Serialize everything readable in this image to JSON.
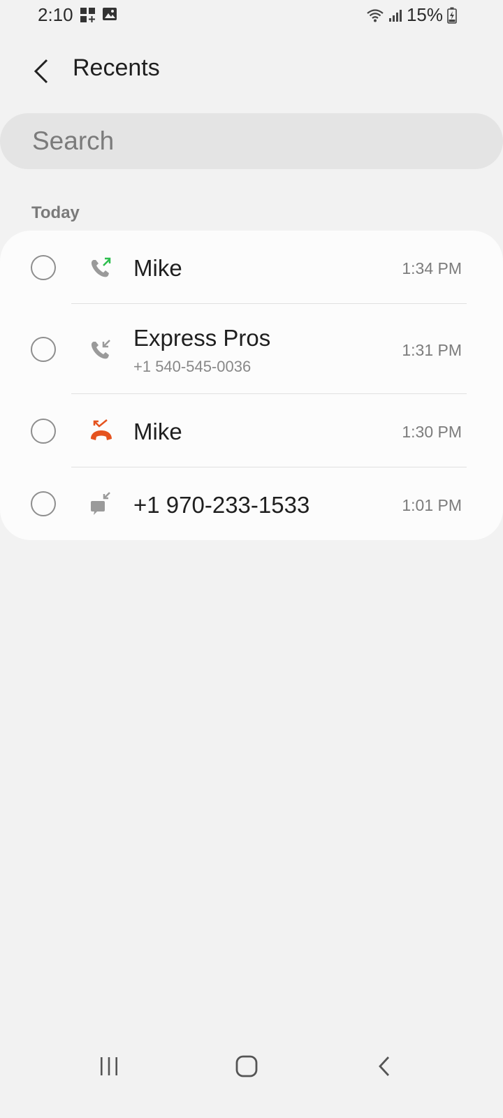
{
  "status_bar": {
    "time": "2:10",
    "battery": "15%"
  },
  "header": {
    "title": "Recents"
  },
  "search": {
    "placeholder": "Search"
  },
  "section": {
    "label": "Today"
  },
  "calls": [
    {
      "name": "Mike",
      "number": "",
      "time": "1:34 PM",
      "type": "outgoing-call-icon"
    },
    {
      "name": "Express Pros",
      "number": "+1 540-545-0036",
      "time": "1:31 PM",
      "type": "incoming-call-icon"
    },
    {
      "name": "Mike",
      "number": "",
      "time": "1:30 PM",
      "type": "missed-call-icon"
    },
    {
      "name": "+1 970-233-1533",
      "number": "",
      "time": "1:01 PM",
      "type": "incoming-message-icon"
    }
  ],
  "colors": {
    "outgoing_arrow": "#2dbe4e",
    "missed": "#e5531f",
    "icon_gray": "#9a9a9a",
    "background": "#f2f2f2"
  }
}
